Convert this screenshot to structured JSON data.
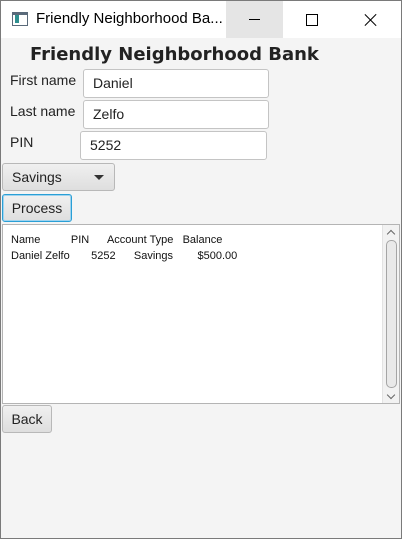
{
  "window": {
    "title": "Friendly Neighborhood Ba..."
  },
  "form": {
    "heading": "Friendly Neighborhood Bank",
    "first_name_label": "First name",
    "first_name_value": "Daniel",
    "last_name_label": "Last name",
    "last_name_value": "Zelfo",
    "pin_label": "PIN",
    "pin_value": "5252",
    "account_type_selected": "Savings",
    "process_label": "Process",
    "back_label": "Back"
  },
  "output": {
    "header": "Name          PIN      Account Type   Balance",
    "row": "Daniel Zelfo       5252      Savings        $500.00"
  },
  "icons": {
    "app": "app-window-icon",
    "minimize": "minimize-icon",
    "maximize": "maximize-icon",
    "close": "close-icon",
    "dropdown": "chevron-down-icon"
  },
  "colors": {
    "focus_border": "#2a9fd6",
    "background": "#f4f4f4"
  }
}
